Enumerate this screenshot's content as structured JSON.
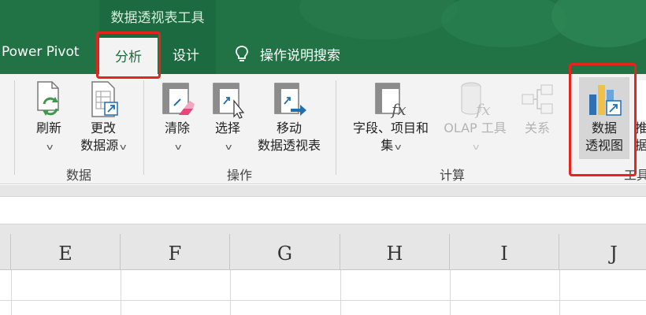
{
  "context_tab_group": "数据透视表工具",
  "tabs": [
    "Power Pivot",
    "分析",
    "设计"
  ],
  "active_tab": "分析",
  "tell_me": "操作说明搜索",
  "ribbon": {
    "groups": {
      "data": "数据",
      "actions": "操作",
      "calculations": "计算",
      "tools": "工具"
    },
    "buttons": {
      "refresh": "刷新",
      "change_source_1": "更改",
      "change_source_2": "数据源",
      "clear": "清除",
      "select": "选择",
      "move_1": "移动",
      "move_2": "数据透视表",
      "fields_1": "字段、项目和",
      "fields_2": "集",
      "olap_1": "OLAP 工具",
      "relations": "关系",
      "pivotchart_1": "数据",
      "pivotchart_2": "透视图",
      "recommend_1": "推",
      "recommend_2": "据"
    }
  },
  "columns": [
    "E",
    "F",
    "G",
    "H",
    "I",
    "J"
  ],
  "highlighted": [
    "分析",
    "数据透视图"
  ],
  "colors": {
    "excel_green": "#217346",
    "highlight_red": "#e8231c",
    "ribbon_bg": "#f3f3f3"
  }
}
